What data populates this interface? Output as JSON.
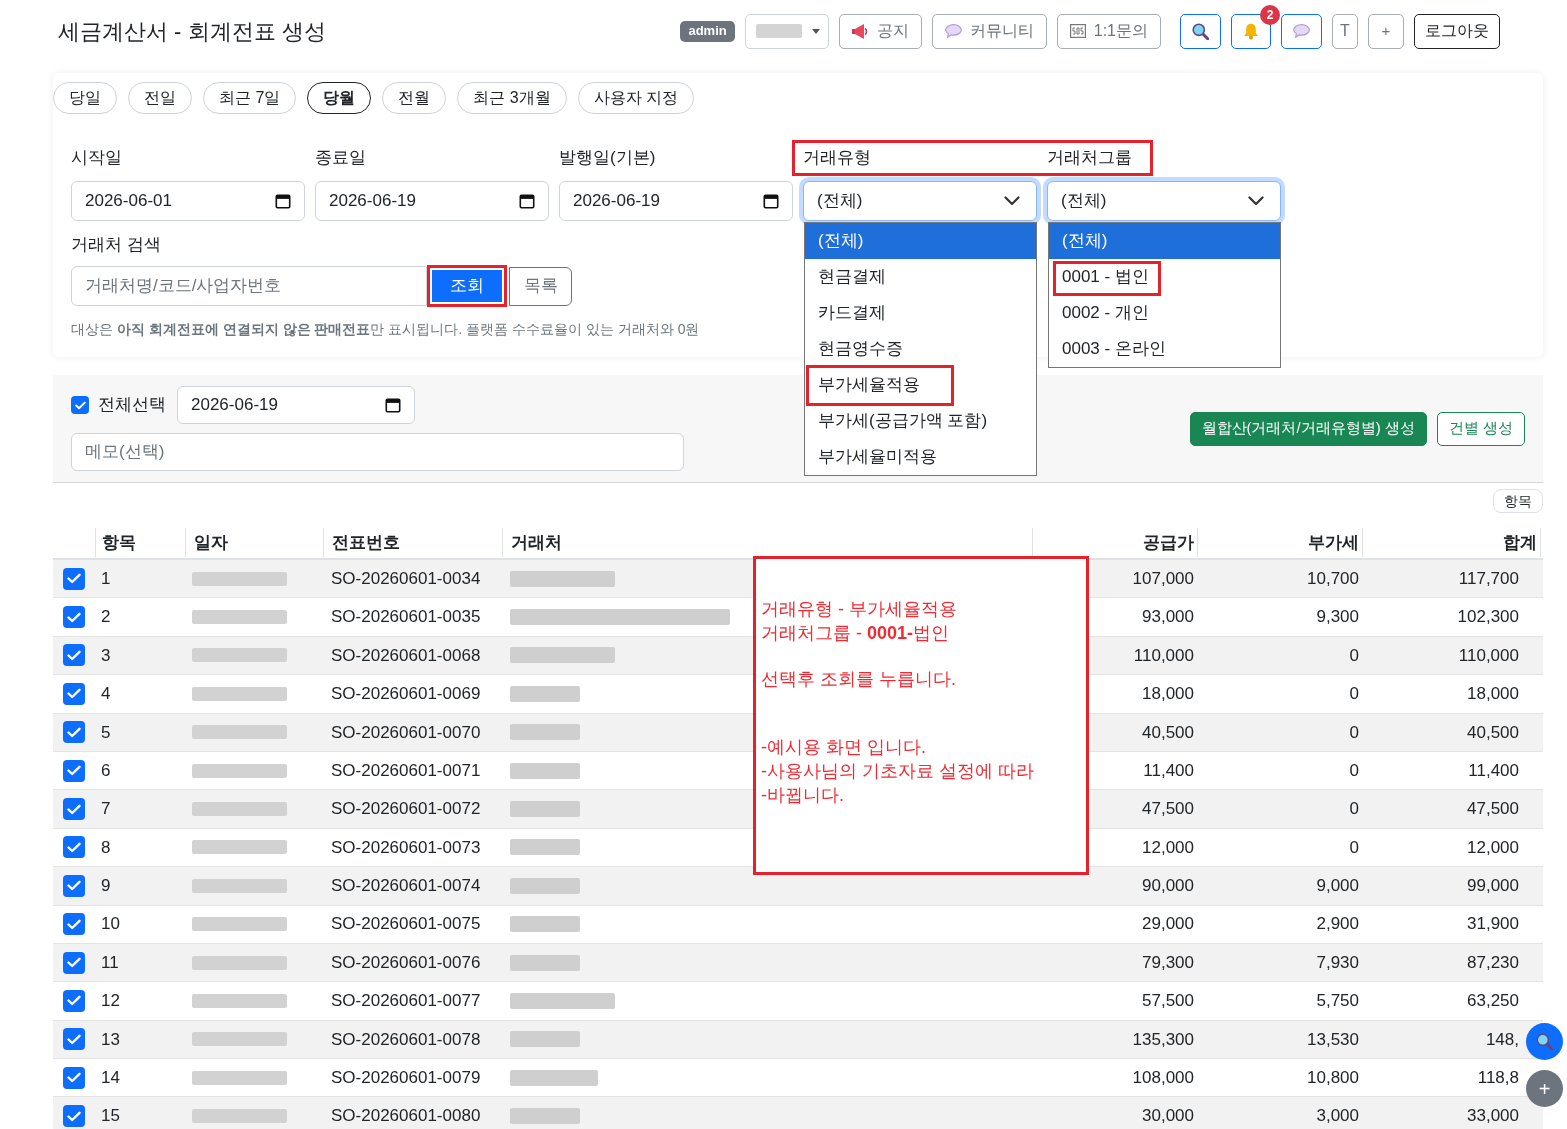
{
  "header": {
    "title": "세금계산서 - 회계전표 생성",
    "user_badge": "admin",
    "links": [
      {
        "label": "공지"
      },
      {
        "label": "커뮤니티"
      },
      {
        "label": "1:1문의"
      }
    ],
    "notification_badge": "2",
    "text_buttons": [
      "T",
      "+"
    ],
    "logout": "로그아웃"
  },
  "period_tabs": [
    {
      "label": "당일",
      "selected": false
    },
    {
      "label": "전일",
      "selected": false
    },
    {
      "label": "최근 7일",
      "selected": false
    },
    {
      "label": "당월",
      "selected": true
    },
    {
      "label": "전월",
      "selected": false
    },
    {
      "label": "최근 3개월",
      "selected": false
    },
    {
      "label": "사용자 지정",
      "selected": false
    }
  ],
  "filters": {
    "start_date": {
      "label": "시작일",
      "value": "2026-06-01"
    },
    "end_date": {
      "label": "종료일",
      "value": "2026-06-19"
    },
    "issue_date": {
      "label": "발행일(기본)",
      "value": "2026-06-19"
    },
    "labels_highlighted": true,
    "trade_type": {
      "label": "거래유형",
      "value": "(전체)",
      "expanded": true,
      "options": [
        {
          "label": "(전체)",
          "selected": true,
          "highlighted": false
        },
        {
          "label": "현금결제",
          "selected": false,
          "highlighted": false
        },
        {
          "label": "카드결제",
          "selected": false,
          "highlighted": false
        },
        {
          "label": "현금영수증",
          "selected": false,
          "highlighted": false
        },
        {
          "label": "부가세율적용",
          "selected": false,
          "highlighted": true
        },
        {
          "label": "부가세(공급가액 포함)",
          "selected": false,
          "highlighted": false
        },
        {
          "label": "부가세율미적용",
          "selected": false,
          "highlighted": false
        }
      ]
    },
    "customer_group": {
      "label": "거래처그룹",
      "value": "(전체)",
      "expanded": true,
      "options": [
        {
          "label": "(전체)",
          "selected": true,
          "highlighted": false
        },
        {
          "label": "0001 - 법인",
          "selected": false,
          "highlighted": true
        },
        {
          "label": "0002 - 개인",
          "selected": false,
          "highlighted": false
        },
        {
          "label": "0003 - 온라인",
          "selected": false,
          "highlighted": false
        }
      ]
    },
    "customer_search": {
      "label": "거래처 검색",
      "placeholder": "거래처명/코드/사업자번호"
    },
    "search_button": {
      "label": "조회",
      "highlighted": true
    },
    "list_button": "목록",
    "notice": "대상은 **아직 회계전표에 연결되지 않은 판매전표**만 표시됩니다. 플랫폼 수수료율이 있는 거래처와 0원"
  },
  "batch": {
    "select_all": {
      "label": "전체선택",
      "checked": true
    },
    "date": "2026-06-19",
    "memo_placeholder": "메모(선택)",
    "buttons": [
      {
        "label": "월합산(거래처/거래유형별) 생성",
        "kind": "primary"
      },
      {
        "label": "건별 생성",
        "kind": "outline"
      }
    ]
  },
  "table": {
    "columns_button": "항목",
    "columns": [
      "항목",
      "일자",
      "전표번호",
      "거래처",
      "공급가",
      "부가세",
      "합계"
    ],
    "rows": [
      {
        "checked": true,
        "no": "1",
        "slip": "SO-20260601-0034",
        "supply": "107,000",
        "vat": "10,700",
        "total": "117,700"
      },
      {
        "checked": true,
        "no": "2",
        "slip": "SO-20260601-0035",
        "supply": "93,000",
        "vat": "9,300",
        "total": "102,300"
      },
      {
        "checked": true,
        "no": "3",
        "slip": "SO-20260601-0068",
        "supply": "110,000",
        "vat": "0",
        "total": "110,000"
      },
      {
        "checked": true,
        "no": "4",
        "slip": "SO-20260601-0069",
        "supply": "18,000",
        "vat": "0",
        "total": "18,000"
      },
      {
        "checked": true,
        "no": "5",
        "slip": "SO-20260601-0070",
        "supply": "40,500",
        "vat": "0",
        "total": "40,500"
      },
      {
        "checked": true,
        "no": "6",
        "slip": "SO-20260601-0071",
        "supply": "11,400",
        "vat": "0",
        "total": "11,400"
      },
      {
        "checked": true,
        "no": "7",
        "slip": "SO-20260601-0072",
        "supply": "47,500",
        "vat": "0",
        "total": "47,500"
      },
      {
        "checked": true,
        "no": "8",
        "slip": "SO-20260601-0073",
        "supply": "12,000",
        "vat": "0",
        "total": "12,000"
      },
      {
        "checked": true,
        "no": "9",
        "slip": "SO-20260601-0074",
        "supply": "90,000",
        "vat": "9,000",
        "total": "99,000"
      },
      {
        "checked": true,
        "no": "10",
        "slip": "SO-20260601-0075",
        "supply": "29,000",
        "vat": "2,900",
        "total": "31,900"
      },
      {
        "checked": true,
        "no": "11",
        "slip": "SO-20260601-0076",
        "supply": "79,300",
        "vat": "7,930",
        "total": "87,230"
      },
      {
        "checked": true,
        "no": "12",
        "slip": "SO-20260601-0077",
        "supply": "57,500",
        "vat": "5,750",
        "total": "63,250"
      },
      {
        "checked": true,
        "no": "13",
        "slip": "SO-20260601-0078",
        "supply": "135,300",
        "vat": "13,530",
        "total": "148,"
      },
      {
        "checked": true,
        "no": "14",
        "slip": "SO-20260601-0079",
        "supply": "108,000",
        "vat": "10,800",
        "total": "118,8"
      },
      {
        "checked": true,
        "no": "15",
        "slip": "SO-20260601-0080",
        "supply": "30,000",
        "vat": "3,000",
        "total": "33,000"
      }
    ]
  },
  "annotation": {
    "paragraphs": [
      [
        "거래유형 - 부가세율적용",
        "거래처그룹 - **0001-**법인"
      ],
      [
        "선택후 조회를 누릅니다."
      ],
      [
        "-예시용 화면 입니다.",
        "-사용사님의 기초자료 설정에 따라",
        "-바뀝니다."
      ]
    ]
  },
  "floating": {
    "add": "+"
  }
}
